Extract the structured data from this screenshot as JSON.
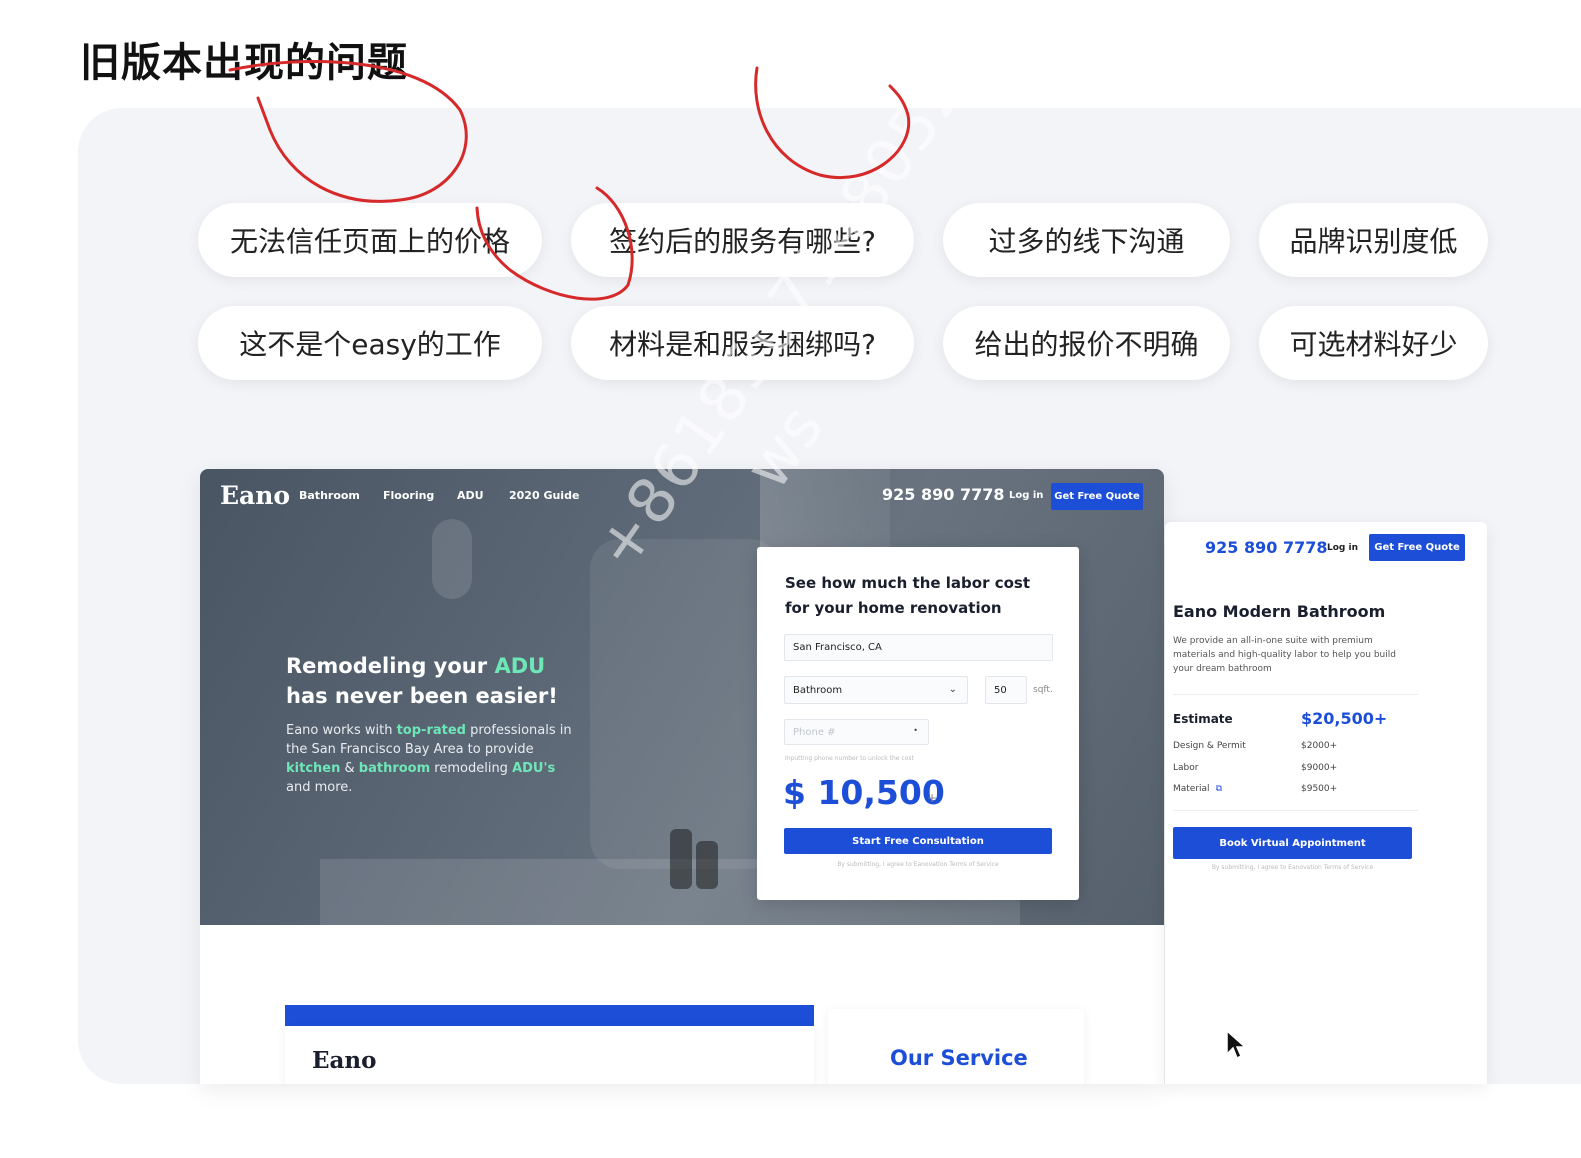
{
  "slide": {
    "title": "旧版本出现的问题",
    "issues": [
      "无法信任页面上的价格",
      "签约后的服务有哪些?",
      "过多的线下沟通",
      "品牌识别度低",
      "这不是个easy的工作",
      "材料是和服务捆绑吗?",
      "给出的报价不明确",
      "可选材料好少"
    ],
    "watermark_1": "ws",
    "watermark_2": "+8618507148052"
  },
  "main": {
    "logo": "Eano",
    "nav": [
      "Bathroom",
      "Flooring",
      "ADU",
      "2020 Guide"
    ],
    "phone": "925 890 7778",
    "login": "Log in",
    "quote_button": "Get Free Quote",
    "hero": {
      "line1_prefix": "Remodeling your",
      "line1_highlight": "ADU",
      "line2": "has never been easier!",
      "p_1": "Eano works with",
      "p_hl1": "top-rated",
      "p_2": "professionals in the San Francisco Bay Area to provide",
      "p_hl2": "kitchen",
      "p_3": "&",
      "p_hl3": "bathroom",
      "p_4": "remodeling",
      "p_hl4": "ADU's",
      "p_5": "and more."
    },
    "calculator": {
      "title": "See how much the labor cost for your home renovation",
      "location": "San Francisco, CA",
      "room": "Bathroom",
      "size": "50",
      "unit": "sqft.",
      "phone_placeholder": "Phone #",
      "hint": "Inputting phone number to unlock the cost",
      "price": "$ 10,500",
      "plus": "+",
      "button": "Start Free Consultation",
      "terms": "By submitting, I agree to Eanovation Terms of Service"
    },
    "lower": {
      "logo": "Eano",
      "service": "Our Service"
    }
  },
  "side": {
    "phone": "925 890 7778",
    "login": "Log in",
    "quote_button": "Get Free Quote",
    "title": "Eano Modern Bathroom",
    "description": "We provide an all-in-one suite with premium materials and high-quality labor to help you build your dream bathroom",
    "estimate_label": "Estimate",
    "estimate_value": "$20,500+",
    "rows": [
      {
        "label": "Design & Permit",
        "value": "$2000+"
      },
      {
        "label": "Labor",
        "value": "$9000+"
      },
      {
        "label": "Material",
        "value": "$9500+"
      }
    ],
    "link_icon": "external-link-icon",
    "book_button": "Book Virtual Appointment",
    "terms": "By submitting, I agree to Eanovation Terms of Service"
  },
  "colors": {
    "brand_blue": "#1d4ed8",
    "accent_green": "#6ee7b7",
    "annotation_red": "#d62a2a"
  }
}
